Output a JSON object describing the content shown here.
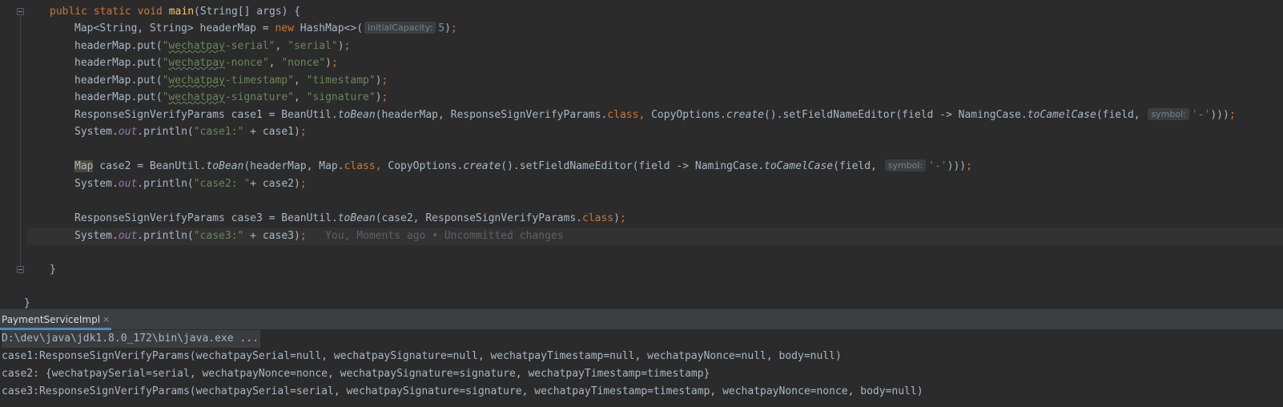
{
  "editor": {
    "lines": [
      {
        "segments": [
          {
            "t": "public static void ",
            "c": "kw"
          },
          {
            "t": "main",
            "c": "fn"
          },
          {
            "t": "(String[] args) {"
          }
        ]
      },
      {
        "segments": [
          {
            "t": "Map<String, String> headerMap = "
          },
          {
            "t": "new ",
            "c": "kw"
          },
          {
            "t": "HashMap<>("
          },
          {
            "t": "initialCapacity:",
            "c": "hint"
          },
          {
            "t": "5",
            "c": "num"
          },
          {
            "t": ")"
          },
          {
            "t": ";",
            "c": "kw"
          }
        ]
      },
      {
        "segments": [
          {
            "t": "headerMap.put("
          },
          {
            "t": "\"",
            "c": "str"
          },
          {
            "t": "wechatpay",
            "c": "str typo"
          },
          {
            "t": "-serial\"",
            "c": "str"
          },
          {
            "t": ", "
          },
          {
            "t": "\"serial\"",
            "c": "str"
          },
          {
            "t": ")"
          },
          {
            "t": ";",
            "c": "kw"
          }
        ]
      },
      {
        "segments": [
          {
            "t": "headerMap.put("
          },
          {
            "t": "\"",
            "c": "str"
          },
          {
            "t": "wechatpay",
            "c": "str typo"
          },
          {
            "t": "-nonce\"",
            "c": "str"
          },
          {
            "t": ", "
          },
          {
            "t": "\"nonce\"",
            "c": "str"
          },
          {
            "t": ")"
          },
          {
            "t": ";",
            "c": "kw"
          }
        ]
      },
      {
        "segments": [
          {
            "t": "headerMap.put("
          },
          {
            "t": "\"",
            "c": "str"
          },
          {
            "t": "wechatpay",
            "c": "str typo"
          },
          {
            "t": "-timestamp\"",
            "c": "str"
          },
          {
            "t": ", "
          },
          {
            "t": "\"timestamp\"",
            "c": "str"
          },
          {
            "t": ")"
          },
          {
            "t": ";",
            "c": "kw"
          }
        ]
      },
      {
        "segments": [
          {
            "t": "headerMap.put("
          },
          {
            "t": "\"",
            "c": "str"
          },
          {
            "t": "wechatpay",
            "c": "str typo"
          },
          {
            "t": "-signature\"",
            "c": "str"
          },
          {
            "t": ", "
          },
          {
            "t": "\"signature\"",
            "c": "str"
          },
          {
            "t": ")"
          },
          {
            "t": ";",
            "c": "kw"
          }
        ]
      },
      {
        "segments": [
          {
            "t": "ResponseSignVerifyParams case1 = BeanUtil."
          },
          {
            "t": "toBean",
            "c": "it"
          },
          {
            "t": "(headerMap, ResponseSignVerifyParams."
          },
          {
            "t": "class",
            "c": "kw"
          },
          {
            "t": ", ",
            "c": "kw"
          },
          {
            "t": "CopyOptions."
          },
          {
            "t": "create",
            "c": "it"
          },
          {
            "t": "().setFieldNameEditor(field -> NamingCase."
          },
          {
            "t": "toCamelCase",
            "c": "it"
          },
          {
            "t": "(field, "
          },
          {
            "t": "symbol:",
            "c": "hint"
          },
          {
            "t": "'-'",
            "c": "str"
          },
          {
            "t": ")))"
          },
          {
            "t": ";",
            "c": "kw"
          }
        ]
      },
      {
        "segments": [
          {
            "t": "System."
          },
          {
            "t": "out",
            "c": "st"
          },
          {
            "t": ".println("
          },
          {
            "t": "\"case1:\"",
            "c": "str"
          },
          {
            "t": " + case1)"
          },
          {
            "t": ";",
            "c": "kw"
          }
        ]
      },
      {
        "segments": []
      },
      {
        "segments": [
          {
            "t": "Map",
            "c": "hl"
          },
          {
            "t": " case2 = BeanUtil."
          },
          {
            "t": "toBean",
            "c": "it"
          },
          {
            "t": "(headerMap, Map."
          },
          {
            "t": "class",
            "c": "kw"
          },
          {
            "t": ", ",
            "c": "kw"
          },
          {
            "t": "CopyOptions."
          },
          {
            "t": "create",
            "c": "it"
          },
          {
            "t": "().setFieldNameEditor(field -> NamingCase."
          },
          {
            "t": "toCamelCase",
            "c": "it"
          },
          {
            "t": "(field, "
          },
          {
            "t": "symbol:",
            "c": "hint"
          },
          {
            "t": "'-'",
            "c": "str"
          },
          {
            "t": ")))"
          },
          {
            "t": ";",
            "c": "kw"
          }
        ]
      },
      {
        "segments": [
          {
            "t": "System."
          },
          {
            "t": "out",
            "c": "st"
          },
          {
            "t": ".println("
          },
          {
            "t": "\"case2: \"",
            "c": "str"
          },
          {
            "t": "+ case2)"
          },
          {
            "t": ";",
            "c": "kw"
          }
        ]
      },
      {
        "segments": []
      },
      {
        "segments": [
          {
            "t": "ResponseSignVerifyParams case3 = BeanUtil."
          },
          {
            "t": "toBean",
            "c": "it"
          },
          {
            "t": "(case2, ResponseSignVerifyParams."
          },
          {
            "t": "class",
            "c": "kw"
          },
          {
            "t": ")"
          },
          {
            "t": ";",
            "c": "kw"
          }
        ]
      },
      {
        "segments": [
          {
            "t": "System."
          },
          {
            "t": "out",
            "c": "st"
          },
          {
            "t": ".println("
          },
          {
            "t": "\"case3:\"",
            "c": "str"
          },
          {
            "t": " + case3)"
          },
          {
            "t": ";",
            "c": "kw"
          },
          {
            "t": "   You, Moments ago • Uncommitted changes",
            "c": "blame"
          }
        ]
      },
      {
        "segments": []
      },
      {
        "segments": [
          {
            "t": "}"
          }
        ]
      }
    ],
    "closing_brace": "}"
  },
  "run_panel": {
    "tab_label": "PaymentServiceImpl",
    "close_glyph": "×",
    "output": [
      "D:\\dev\\java\\jdk1.8.0_172\\bin\\java.exe ...",
      "case1:ResponseSignVerifyParams(wechatpaySerial=null, wechatpaySignature=null, wechatpayTimestamp=null, wechatpayNonce=null, body=null)",
      "case2: {wechatpaySerial=serial, wechatpayNonce=nonce, wechatpaySignature=signature, wechatpayTimestamp=timestamp}",
      "case3:ResponseSignVerifyParams(wechatpaySerial=serial, wechatpaySignature=signature, wechatpayTimestamp=timestamp, wechatpayNonce=nonce, body=null)"
    ]
  },
  "colors": {
    "background": "#2b2b2b",
    "keyword": "#cc7832",
    "method_decl": "#ffc66d",
    "string": "#6a8759",
    "static_field": "#9876aa",
    "number": "#6897bb",
    "text": "#a9b7c6",
    "tab_underline": "#4a88c7"
  }
}
